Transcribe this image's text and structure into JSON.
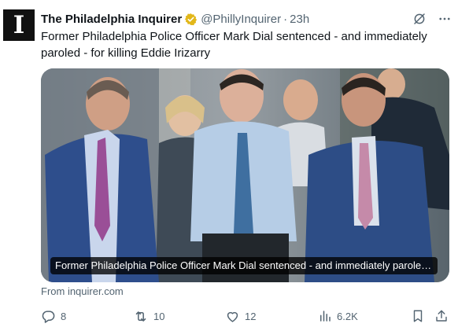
{
  "account": {
    "name": "The Philadelphia Inquirer",
    "handle": "@PhillyInquirer",
    "separator": "·",
    "time": "23h",
    "avatar_icon": "inquirer-logo-icon",
    "avatar_glyph": "I",
    "verified_color": "#e2b719"
  },
  "tweet": {
    "text": "Former Philadelphia Police Officer Mark Dial sentenced - and immediately paroled - for killing Eddie Irizarry"
  },
  "card": {
    "caption": "Former Philadelphia Police Officer Mark Dial sentenced - and immediately paroled - for killing Eddie Irizarry",
    "source": "From inquirer.com"
  },
  "actions": {
    "reply": {
      "icon": "reply-icon",
      "count": "8"
    },
    "repost": {
      "icon": "repost-icon",
      "count": "10"
    },
    "like": {
      "icon": "heart-icon",
      "count": "12"
    },
    "views": {
      "icon": "views-icon",
      "count": "6.2K"
    },
    "bookmark": {
      "icon": "bookmark-icon"
    },
    "share": {
      "icon": "share-icon"
    }
  },
  "colors": {
    "text_primary": "#0f1419",
    "text_secondary": "#536471"
  }
}
